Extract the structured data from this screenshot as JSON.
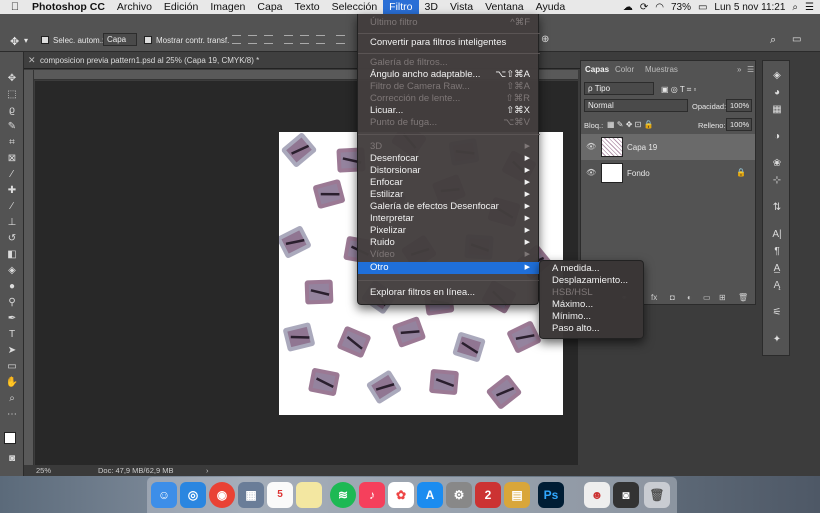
{
  "menubar": {
    "apple": "",
    "items": [
      "Photoshop CC",
      "Archivo",
      "Edición",
      "Imagen",
      "Capa",
      "Texto",
      "Selección",
      "Filtro",
      "3D",
      "Vista",
      "Ventana",
      "Ayuda"
    ],
    "active_item": "Filtro",
    "battery": "73%",
    "datetime": "Lun 5 nov  11:21"
  },
  "options_bar": {
    "auto_select_label": "Selec. autom.:",
    "auto_select_value": "Capa",
    "show_transform_label": "Mostrar contr. transf."
  },
  "document": {
    "tab_title": "composicion previa pattern1.psd al 25% (Capa 19, CMYK/8) *",
    "zoom": "25%",
    "doc_size": "Doc: 47,9 MB/62,9 MB"
  },
  "filter_menu": {
    "top_items": [
      {
        "label": "Último filtro",
        "shortcut": "^⌘F",
        "disabled": true
      },
      {
        "label": "Convertir para filtros inteligentes",
        "shortcut": "",
        "disabled": false
      }
    ],
    "gallery_items": [
      {
        "label": "Galería de filtros...",
        "shortcut": "",
        "disabled": true
      },
      {
        "label": "Ángulo ancho adaptable...",
        "shortcut": "⌥⇧⌘A",
        "disabled": false
      },
      {
        "label": "Filtro de Camera Raw...",
        "shortcut": "⇧⌘A",
        "disabled": true
      },
      {
        "label": "Corrección de lente...",
        "shortcut": "⇧⌘R",
        "disabled": true
      },
      {
        "label": "Licuar...",
        "shortcut": "⇧⌘X",
        "disabled": false
      },
      {
        "label": "Punto de fuga...",
        "shortcut": "⌥⌘V",
        "disabled": true
      }
    ],
    "category_items": [
      {
        "label": "3D",
        "disabled": true
      },
      {
        "label": "Desenfocar",
        "disabled": false
      },
      {
        "label": "Distorsionar",
        "disabled": false
      },
      {
        "label": "Enfocar",
        "disabled": false
      },
      {
        "label": "Estilizar",
        "disabled": false
      },
      {
        "label": "Galería de efectos Desenfocar",
        "disabled": false
      },
      {
        "label": "Interpretar",
        "disabled": false
      },
      {
        "label": "Pixelizar",
        "disabled": false
      },
      {
        "label": "Ruido",
        "disabled": false
      },
      {
        "label": "Vídeo",
        "disabled": true
      },
      {
        "label": "Otro",
        "disabled": false,
        "highlighted": true
      }
    ],
    "browse_item": "Explorar filtros en línea..."
  },
  "submenu_otro": [
    {
      "label": "A medida...",
      "disabled": false
    },
    {
      "label": "Desplazamiento...",
      "disabled": false
    },
    {
      "label": "HSB/HSL",
      "disabled": true
    },
    {
      "label": "Máximo...",
      "disabled": false
    },
    {
      "label": "Mínimo...",
      "disabled": false
    },
    {
      "label": "Paso alto...",
      "disabled": false
    }
  ],
  "layers_panel": {
    "tabs": [
      "Capas",
      "Color",
      "Muestras"
    ],
    "active_tab": "Capas",
    "filter_kind": "ρ Tipo",
    "blend_mode": "Normal",
    "opacity_label": "Opacidad:",
    "opacity_value": "100%",
    "lock_label": "Bloq.:",
    "fill_label": "Relleno:",
    "fill_value": "100%",
    "layers": [
      {
        "name": "Capa 19",
        "selected": true
      },
      {
        "name": "Fondo",
        "selected": false,
        "locked": true
      }
    ]
  },
  "colors": {
    "menu_highlight": "#1f6fd9",
    "paint_purple": "#7a4c70",
    "paint_grey": "#8e8ca6"
  }
}
